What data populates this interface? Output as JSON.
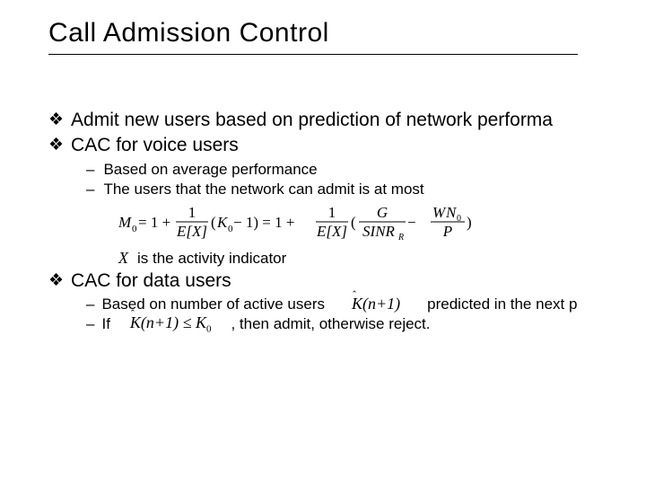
{
  "title": "Call Admission Control",
  "bullets": {
    "b1": "Admit new users based on prediction of network performa",
    "b2": "CAC for voice users",
    "b2s1": "Based on average performance",
    "b2s2": "The users that the network can admit is at most",
    "indicator_tail": "is the activity indicator",
    "b3": "CAC for data users",
    "b3s1_a": "Based on number of active users",
    "b3s1_b": "predicted in the next p",
    "b3s2_a": "If",
    "b3s2_b": ", then admit, otherwise reject."
  },
  "symbols": {
    "diamond": "❖",
    "dash": "–"
  },
  "math": {
    "X_var": "X",
    "Khat_n1": "K(n+1)",
    "Khat_n1_leq_K0_left": "K(n+1) ≤ K",
    "K0_sub": "0"
  },
  "formula": {
    "M0": "M",
    "M0sub": "0",
    "eq": " = 1 + ",
    "one": "1",
    "EX": "E[X]",
    "K0": "K",
    "K0sub": "0",
    "minus1": " − 1) = 1 + ",
    "open2": "(",
    "G": "G",
    "SINR": "SINR",
    "Rsub": "R",
    "minus": " − ",
    "W": "W",
    "N0": "N",
    "N0sub": "0",
    "P": "P"
  }
}
